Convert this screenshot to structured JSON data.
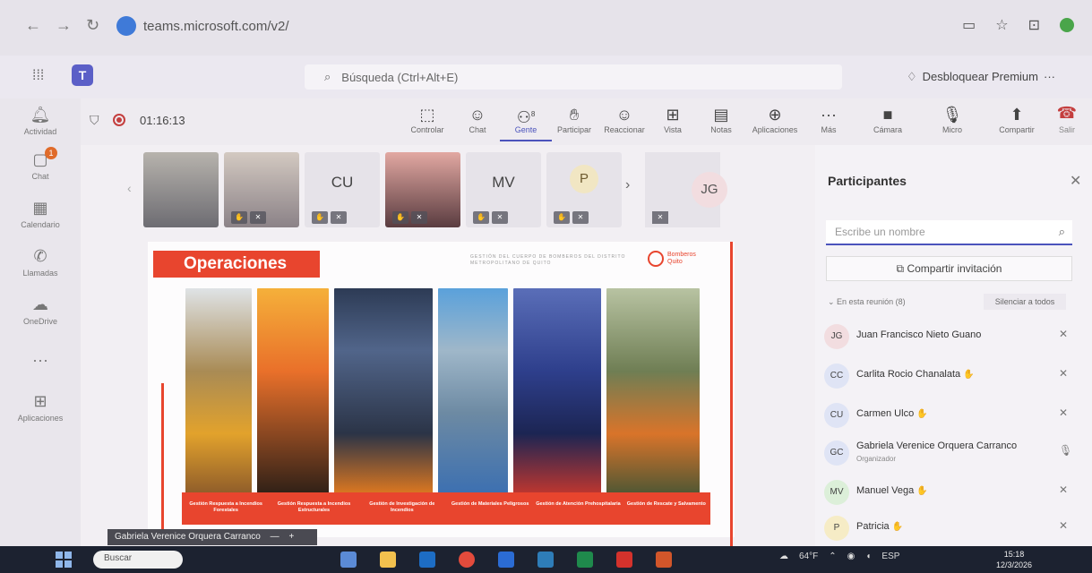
{
  "browser": {
    "url": "teams.microsoft.com/v2/"
  },
  "teams": {
    "search_placeholder": "Búsqueda (Ctrl+Alt+E)",
    "premium_label": "Desbloquear Premium",
    "premium_more": "···"
  },
  "rail": [
    {
      "label": "Actividad",
      "icon": "bell-icon"
    },
    {
      "label": "Chat",
      "icon": "chat-icon",
      "badge": "1"
    },
    {
      "label": "Calendario",
      "icon": "calendar-icon"
    },
    {
      "label": "Llamadas",
      "icon": "phone-icon"
    },
    {
      "label": "OneDrive",
      "icon": "cloud-icon"
    },
    {
      "label": "Aplicaciones",
      "icon": "add-apps-icon"
    }
  ],
  "rail_more": "···",
  "meeting": {
    "timer": "01:16:13",
    "tools": [
      {
        "label": "Controlar",
        "icon": "control-icon"
      },
      {
        "label": "Chat",
        "icon": "chat-icon"
      },
      {
        "label": "Gente",
        "icon": "people-icon",
        "count": "8",
        "active": true
      },
      {
        "label": "Participar",
        "icon": "raise-hand-icon"
      },
      {
        "label": "Reaccionar",
        "icon": "react-icon"
      },
      {
        "label": "Vista",
        "icon": "view-icon"
      },
      {
        "label": "Notas",
        "icon": "notes-icon"
      },
      {
        "label": "Aplicaciones",
        "icon": "apps-icon"
      },
      {
        "label": "Más",
        "icon": "more-icon"
      },
      {
        "label": "Cámara",
        "icon": "camera-off-icon"
      },
      {
        "label": "Micro",
        "icon": "mic-off-icon"
      },
      {
        "label": "Compartir",
        "icon": "share-icon"
      }
    ],
    "leave_label": "Salir",
    "strip": [
      {
        "type": "video",
        "name": "video-tile-1"
      },
      {
        "type": "video",
        "name": "video-tile-2"
      },
      {
        "type": "initials",
        "initials": "CU"
      },
      {
        "type": "video",
        "name": "video-tile-3"
      },
      {
        "type": "initials",
        "initials": "MV"
      },
      {
        "type": "circle",
        "initials": "P"
      }
    ],
    "strip_more": "›",
    "strip_jg": "JG",
    "presenter_tag": "Gabriela Verenice Orquera Carranco"
  },
  "slide": {
    "title": "Operaciones",
    "header_text": "GESTIÓN DEL CUERPO DE BOMBEROS DEL DISTRITO METROPOLITANO DE QUITO",
    "brand": "Bomberos Quito",
    "captions": [
      "Gestión Respuesta a Incendios Forestales",
      "Gestión Respuesta a Incendios Estructurales",
      "Gestión de Investigación de Incendios",
      "Gestión de Materiales Peligrosos",
      "Gestión de Atención Prehospitalaria",
      "Gestión de Rescate y Salvamento"
    ]
  },
  "participants": {
    "title": "Participantes",
    "search_placeholder": "Escribe un nombre",
    "invite_label": "Compartir invitación",
    "section_label": "En esta reunión (8)",
    "mute_all": "Silenciar a todos",
    "list": [
      {
        "initials": "JG",
        "name": "Juan Francisco Nieto Guano",
        "role": "",
        "color": "#f2dde0",
        "hand": false
      },
      {
        "initials": "CC",
        "name": "Carlita Rocio Chanalata",
        "role": "",
        "color": "#dfe4f5",
        "hand": true
      },
      {
        "initials": "CU",
        "name": "Carmen Ulco",
        "role": "",
        "color": "#dfe4f5",
        "hand": true
      },
      {
        "initials": "GC",
        "name": "Gabriela Verenice Orquera Carranco",
        "role": "Organizador",
        "color": "#dfe4f5",
        "hand": false
      },
      {
        "initials": "MV",
        "name": "Manuel Vega",
        "role": "",
        "color": "#dcefd9",
        "hand": true
      },
      {
        "initials": "P",
        "name": "Patricia",
        "role": "",
        "color": "#f6ecc6",
        "hand": true
      }
    ]
  },
  "taskbar": {
    "search_label": "Buscar",
    "weather": "64°F",
    "lang": "ESP",
    "time": "15:18",
    "date": "12/3/2026"
  }
}
